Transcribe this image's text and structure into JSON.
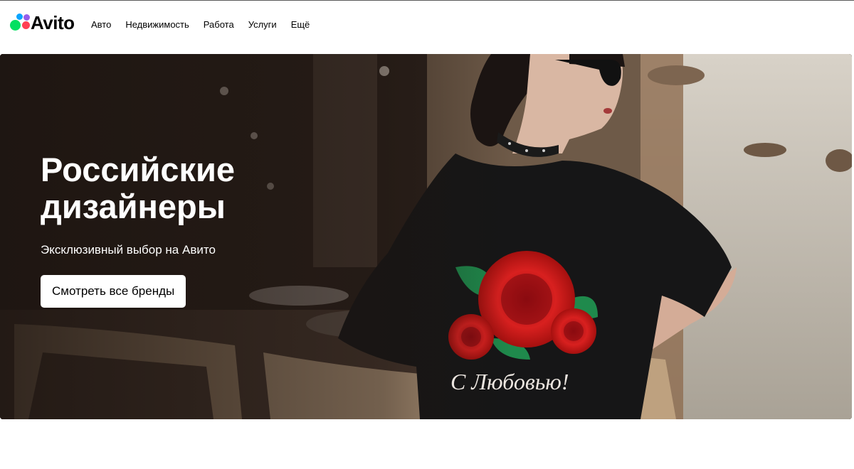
{
  "header": {
    "logo_text": "Avito",
    "logo_colors": {
      "green": "#04e061",
      "blue": "#0aa5ff",
      "red": "#ff4053",
      "purple": "#965eeb"
    },
    "nav": [
      {
        "label": "Авто"
      },
      {
        "label": "Недвижимость"
      },
      {
        "label": "Работа"
      },
      {
        "label": "Услуги"
      },
      {
        "label": "Ещё"
      }
    ]
  },
  "hero": {
    "title": "Российские дизайнеры",
    "subtitle": "Эксклюзивный выбор на Авито",
    "button_label": "Смотреть все бренды",
    "shirt_print_text": "С Любовью!"
  }
}
